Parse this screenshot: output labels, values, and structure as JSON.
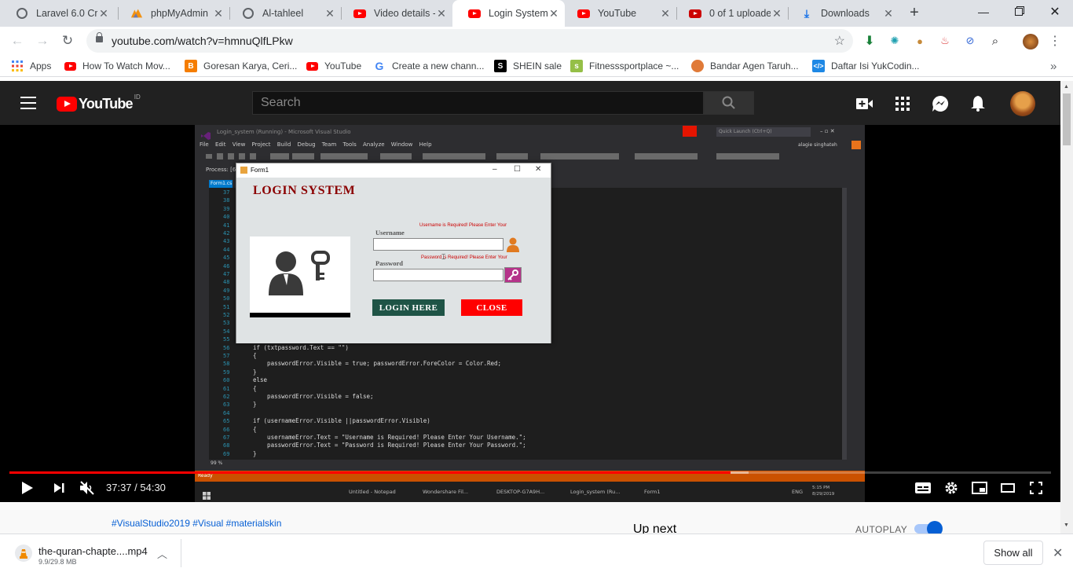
{
  "browser": {
    "tabs": [
      {
        "label": "Laravel 6.0 Cru",
        "icon": "globe-icon",
        "active": false
      },
      {
        "label": "phpMyAdmin",
        "icon": "phpmyadmin-icon",
        "active": false
      },
      {
        "label": "Al-tahleel",
        "icon": "globe-icon",
        "active": false
      },
      {
        "label": "Video details -",
        "icon": "youtube-icon",
        "active": false
      },
      {
        "label": "Login System I",
        "icon": "youtube-icon",
        "active": true
      },
      {
        "label": "YouTube",
        "icon": "youtube-icon",
        "active": false
      },
      {
        "label": "0 of 1 uploade",
        "icon": "youtube-studio-icon",
        "active": false
      },
      {
        "label": "Downloads",
        "icon": "download-icon",
        "active": false
      }
    ],
    "new_tab": "+",
    "url": "youtube.com/watch?v=hmnuQlfLPkw",
    "bookmarks": [
      {
        "label": "Apps",
        "icon": "apps-icon"
      },
      {
        "label": "How To Watch Mov...",
        "icon": "youtube-icon"
      },
      {
        "label": "Goresan Karya, Ceri...",
        "icon": "blogger-icon"
      },
      {
        "label": "YouTube",
        "icon": "youtube-icon"
      },
      {
        "label": "Create a new chann...",
        "icon": "google-icon"
      },
      {
        "label": "SHEIN sale",
        "icon": "shein-icon"
      },
      {
        "label": "Fitnesssportplace ~...",
        "icon": "shopify-icon"
      },
      {
        "label": "Bandar Agen Taruh...",
        "icon": "site-icon"
      },
      {
        "label": "Daftar Isi YukCodin...",
        "icon": "code-icon"
      }
    ],
    "more_bookmarks": "»"
  },
  "youtube": {
    "logo_word": "YouTube",
    "country_code": "ID",
    "search_placeholder": "Search"
  },
  "video": {
    "vs_title": "Login_system (Running) - Microsoft Visual Studio",
    "vs_menu": "File  Edit  View  Project  Build  Debug  Team  Tools  Analyze  Window  Help",
    "vs_process": "Process: [6",
    "vs_quick_launch": "Quick Launch (Ctrl+Q)",
    "vs_user": "alagie singhateh",
    "vs_status": "Ready",
    "line_numbers": [
      "37",
      "38",
      "39",
      "40",
      "41",
      "42",
      "43",
      "44",
      "45",
      "46",
      "47",
      "48",
      "49",
      "50",
      "51",
      "52",
      "53",
      "54",
      "55",
      "56",
      "57",
      "58",
      "59",
      "60",
      "61",
      "62",
      "63",
      "64",
      "65",
      "66",
      "67",
      "68",
      "69"
    ],
    "code_lines": [
      {
        "ln": "56",
        "text": "if (txtpassword.Text == \"\")"
      },
      {
        "ln": "57",
        "text": "{"
      },
      {
        "ln": "58",
        "text": "    passwordError.Visible = true; passwordError.ForeColor = Color.Red;"
      },
      {
        "ln": "59",
        "text": "}"
      },
      {
        "ln": "60",
        "text": "else"
      },
      {
        "ln": "61",
        "text": "{"
      },
      {
        "ln": "62",
        "text": "    passwordError.Visible = false;"
      },
      {
        "ln": "63",
        "text": "}"
      },
      {
        "ln": "64",
        "text": ""
      },
      {
        "ln": "65",
        "text": "if (usernameError.Visible ||passwordError.Visible)"
      },
      {
        "ln": "66",
        "text": "{"
      },
      {
        "ln": "67",
        "text": "    usernameError.Text = \"Username is Required! Please Enter Your Username.\";"
      },
      {
        "ln": "68",
        "text": "    passwordError.Text = \"Password is Required! Please Enter Your Password.\";"
      },
      {
        "ln": "69",
        "text": "}"
      }
    ],
    "taskbar_items": [
      "Untitled - Notepad",
      "Wondershare Fil...",
      "DESKTOP-G7A9H...",
      "Login_system (Ru...",
      "Form1"
    ],
    "taskbar_lang": "ENG",
    "taskbar_time": "5:15 PM",
    "taskbar_date": "8/29/2019",
    "form": {
      "window_title": "Form1",
      "heading": "LOGIN  SYSTEM",
      "username_label": "Username",
      "username_error": "Username is Required! Please Enter Your",
      "password_label": "Password",
      "password_error": "Password is Required! Please Enter Your",
      "login_button": "LOGIN HERE",
      "close_button": "CLOSE",
      "login_color": "#1f5446",
      "close_color": "#ff0000"
    },
    "time_display": "37:37 / 54:30",
    "progress_played": 0.692,
    "progress_loaded": 0.71
  },
  "below": {
    "hashtags": "#VisualStudio2019 #Visual #materialskin",
    "up_next": "Up next",
    "autoplay": "AUTOPLAY"
  },
  "downloads": {
    "file_name": "the-quran-chapte....mp4",
    "file_size": "9.9/29.8 MB",
    "show_all": "Show all"
  }
}
